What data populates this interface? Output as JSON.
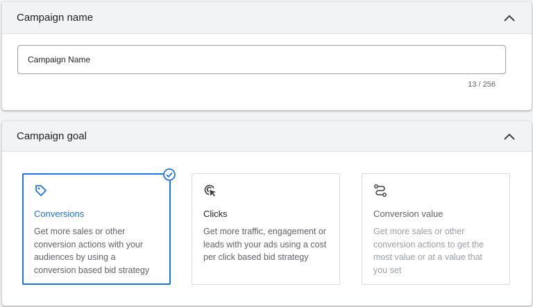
{
  "colors": {
    "accent": "#1a73e8",
    "header_bg": "#f1f3f4",
    "muted": "#5f6368",
    "disabled": "#9aa0a6"
  },
  "campaign_name_section": {
    "title": "Campaign name",
    "toggle_icon": "chevron-up-icon",
    "input_value": "Campaign Name",
    "counter": "13 / 256"
  },
  "campaign_goal_section": {
    "title": "Campaign goal",
    "toggle_icon": "chevron-up-icon",
    "goals": [
      {
        "icon": "tag-icon",
        "title": "Conversions",
        "description": "Get more sales or other conversion actions with your audiences by using a conversion based bid strategy",
        "state": "selected"
      },
      {
        "icon": "cursor-click-icon",
        "title": "Clicks",
        "description": "Get more traffic, engagement or leads with your ads using a cost per click based bid strategy",
        "state": "default"
      },
      {
        "icon": "route-icon",
        "title": "Conversion value",
        "description": "Get more sales or other conversion actions to get the most value or at a value that you set",
        "state": "disabled"
      }
    ]
  }
}
